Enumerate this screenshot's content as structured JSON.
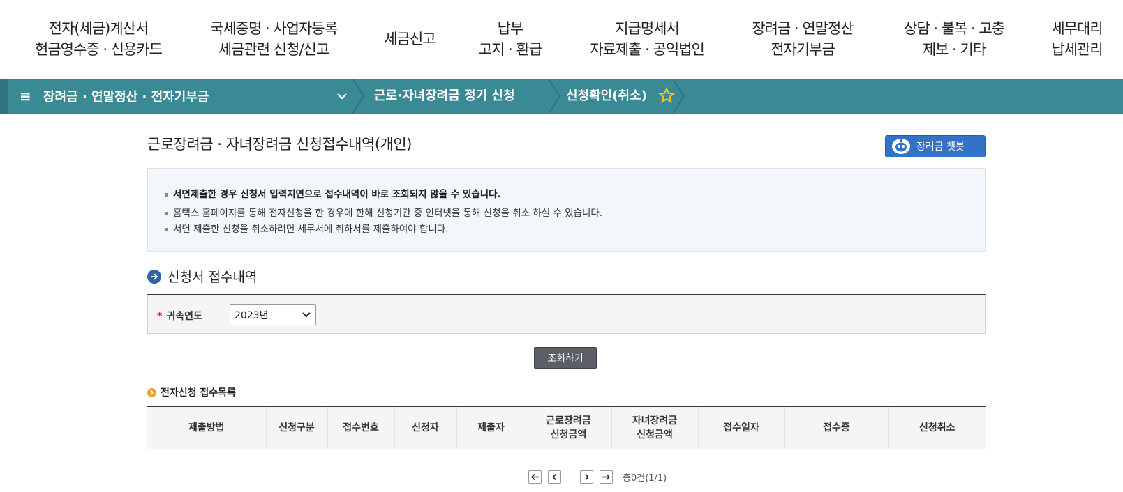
{
  "topnav": {
    "items": [
      {
        "line1": "전자(세금)계산서",
        "line2": "현금영수증 · 신용카드"
      },
      {
        "line1": "국세증명 · 사업자등록",
        "line2": "세금관련 신청/신고"
      },
      {
        "line1": "세금신고",
        "line2": ""
      },
      {
        "line1": "납부",
        "line2": "고지 · 환급"
      },
      {
        "line1": "지급명세서",
        "line2": "자료제출 · 공익법인"
      },
      {
        "line1": "장려금 · 연말정산",
        "line2": "전자기부금"
      },
      {
        "line1": "상담 · 불복 · 고충",
        "line2": "제보 · 기타"
      },
      {
        "line1": "세무대리",
        "line2": "납세관리"
      }
    ]
  },
  "breadcrumb": {
    "menu_label": "장려금 · 연말정산 · 전자기부금",
    "level2": "근로·자녀장려금 정기 신청",
    "level3": "신청확인(취소)"
  },
  "page": {
    "title": "근로장려금 · 자녀장려금 신청접수내역(개인)",
    "chatbot_label": "장려금 챗봇"
  },
  "notice": {
    "lines": [
      "서면제출한 경우 신청서 입력지연으로 접수내역이 바로 조회되지 않을 수 있습니다.",
      "홈택스 홈페이지를 통해 전자신청을 한 경우에 한해 신청기간 중 인터넷을 통해 신청을 취소 하실 수 있습니다.",
      "서면 제출한 신청을 취소하려면 세무서에 취하서를 제출하여야 합니다."
    ]
  },
  "section": {
    "title": "신청서 접수내역",
    "filter_label": "귀속연도",
    "required_mark": "*",
    "year_value": "2023년",
    "search_label": "조회하기"
  },
  "list": {
    "title": "전자신청 접수목록",
    "columns": [
      {
        "l1": "제출방법",
        "l2": ""
      },
      {
        "l1": "신청구분",
        "l2": ""
      },
      {
        "l1": "접수번호",
        "l2": ""
      },
      {
        "l1": "신청자",
        "l2": ""
      },
      {
        "l1": "제출자",
        "l2": ""
      },
      {
        "l1": "근로장려금",
        "l2": "신청금액"
      },
      {
        "l1": "자녀장려금",
        "l2": "신청금액"
      },
      {
        "l1": "접수일자",
        "l2": ""
      },
      {
        "l1": "접수증",
        "l2": ""
      },
      {
        "l1": "신청취소",
        "l2": ""
      }
    ]
  },
  "pager": {
    "summary": "총0건(1/1)"
  },
  "colors": {
    "breadcrumb_bg": "#3a8a95",
    "chatbot_bg": "#3472c8",
    "search_button_bg": "#5a5f66",
    "notice_bg": "#f3f6fa"
  }
}
